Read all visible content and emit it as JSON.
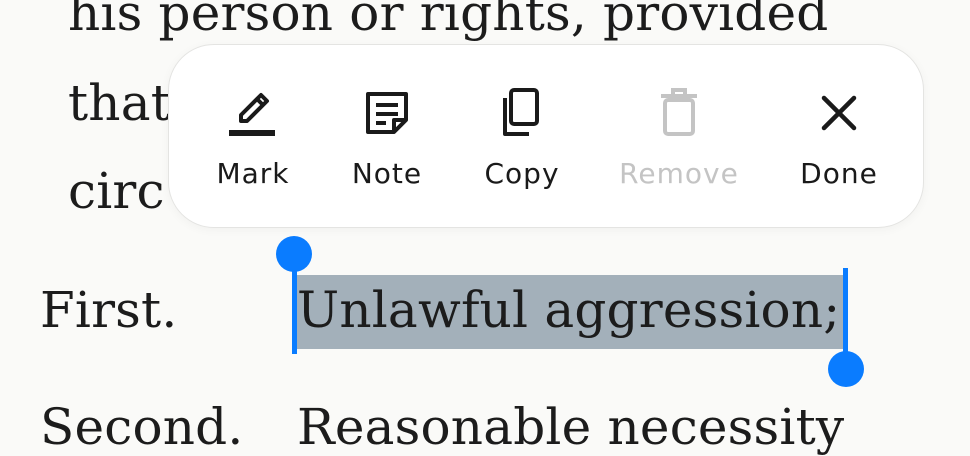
{
  "reader": {
    "lines": [
      "his person or rights, provided",
      "that",
      "circ"
    ],
    "first_label": "First.",
    "first_text": "Unlawful aggression;",
    "second_label": "Second.",
    "second_text": "Reasonable necessity"
  },
  "toolbar": {
    "items": [
      {
        "label": "Mark",
        "icon": "highlighter-icon",
        "enabled": true
      },
      {
        "label": "Note",
        "icon": "note-icon",
        "enabled": true
      },
      {
        "label": "Copy",
        "icon": "copy-icon",
        "enabled": true
      },
      {
        "label": "Remove",
        "icon": "trash-icon",
        "enabled": false
      },
      {
        "label": "Done",
        "icon": "close-icon",
        "enabled": true
      }
    ]
  },
  "colors": {
    "selection": "#a3b0ba",
    "handle": "#0a7cff",
    "disabled": "#c4c4c4"
  }
}
